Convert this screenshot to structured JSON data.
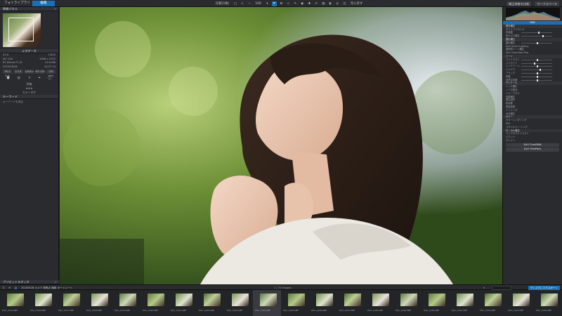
{
  "topbar": {
    "tabs": [
      {
        "label": "フォトライブラリ"
      },
      {
        "label": "編集"
      }
    ],
    "tools": {
      "compare": "比較(1枚)",
      "zoom": "100",
      "undo": "元に戻す"
    },
    "right": {
      "compare_btn": "補正前後を比較",
      "export_btn": "ワークスペース"
    }
  },
  "left_panel": {
    "navigator_title": "情報パネル",
    "metadata_title": "メタデータ",
    "meta_lines": [
      {
        "k": "f/1.8",
        "v": "1/500"
      },
      {
        "k": "ISO 100",
        "v": "3008 x 2712"
      },
      {
        "k": "RF 85mm F1.2L",
        "v": "42.6 MB"
      },
      {
        "k": "2023/05/28",
        "v": "10:27:14"
      }
    ],
    "buttons": [
      "85.0 mm",
      "F/1.8",
      "1/400 s",
      "ISO 100",
      "128 mm"
    ],
    "rating_label": "★★★",
    "label1": "評価",
    "label2": "カラータグ",
    "keywords_title": "キーワード",
    "keyword_placeholder": "キーワードを追加",
    "presets_title": "プリセットエディタ"
  },
  "right_panel": {
    "histogram_buttons": [
      "RGB",
      "輝度"
    ],
    "sections": {
      "basic": "基本補正",
      "wb": "ホワイトバランス",
      "exposure": "露出補正",
      "tone": "トーン",
      "detail": "ディテール",
      "color": "カラー",
      "local": "ローカル補正"
    },
    "rows": [
      "ホワイトバランス",
      "色温度",
      "色かぶり補正",
      "露出補正",
      "DxO Smart Lighting",
      "選択的トーン補正",
      "DxO ClearView Plus",
      "コントラスト",
      "ハイライト",
      "ミッドトーン",
      "シャドウ",
      "ブラック",
      "彩度",
      "自然な彩度",
      "レンズ補正",
      "ノイズ除去",
      "シャープネス",
      "自動補正",
      "周辺減光",
      "色収差",
      "歪曲収差",
      "トリミング",
      "水平補正",
      "カラーレンダリング",
      "HSL",
      "スタイル/トーニング",
      "マイクロコントラスト",
      "ビネット",
      "グレイン"
    ],
    "buttons": [
      "DxO PureRAW",
      "DxO FilmPack"
    ],
    "nav_label": "ナビゲーター"
  },
  "filmbar": {
    "folder": "20230528 カメラ 単焦点 撮影 ポートレート",
    "count": "1 / 70 images",
    "search_placeholder": "検索",
    "export": "ディスクにエクスポート"
  },
  "filmstrip": [
    {
      "name": "DSC_2213.NEF",
      "selected": false
    },
    {
      "name": "DSC_2216.NEF",
      "selected": false
    },
    {
      "name": "DSC_2217.NEF",
      "selected": false
    },
    {
      "name": "DSC_2218.NEF",
      "selected": false
    },
    {
      "name": "DSC_2219.NEF",
      "selected": false
    },
    {
      "name": "DSC_2220.NEF",
      "selected": false
    },
    {
      "name": "DSC_2221.NEF",
      "selected": false
    },
    {
      "name": "DSC_2222.NEF",
      "selected": false
    },
    {
      "name": "DSC_2223.NEF",
      "selected": false
    },
    {
      "name": "DSC_2224.NEF",
      "selected": true
    },
    {
      "name": "DSC_2225.NEF",
      "selected": false
    },
    {
      "name": "DSC_2226.NEF",
      "selected": false
    },
    {
      "name": "DSC_2227.NEF",
      "selected": false
    },
    {
      "name": "DSC_2228.NEF",
      "selected": false
    },
    {
      "name": "DSC_2229.NEF",
      "selected": false
    },
    {
      "name": "DSC_2230.NEF",
      "selected": false
    },
    {
      "name": "DSC_2231.NEF",
      "selected": false
    },
    {
      "name": "DSC_2232.NEF",
      "selected": false
    },
    {
      "name": "DSC_2233.NEF",
      "selected": false
    },
    {
      "name": "DSC_2234.NEF",
      "selected": false
    }
  ],
  "colors": {
    "accent": "#1c6fb4",
    "panel": "#2a2b2f",
    "background": "#1f2023"
  }
}
